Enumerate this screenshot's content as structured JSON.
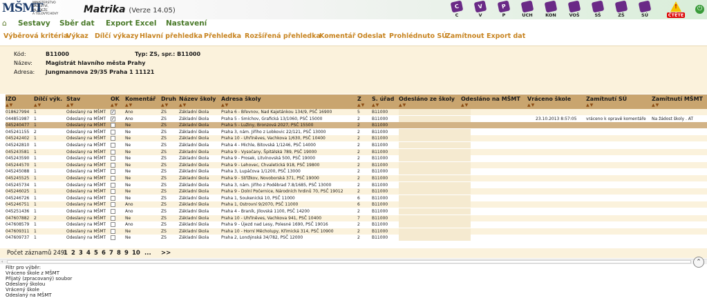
{
  "app": {
    "logo_mark": "MŠMT",
    "logo_text": [
      "MINISTERSTVO",
      "ŠKOLSTVÍ,",
      "MLÁDEŽE",
      "A TĚLOVÝCHOVY"
    ],
    "title": "Matrika",
    "version": "(Verze 14.05)"
  },
  "toolbar_icons": [
    {
      "icon": "c-icon",
      "label": "C"
    },
    {
      "icon": "v-icon",
      "label": "V"
    },
    {
      "icon": "p-icon",
      "label": "P"
    },
    {
      "icon": "uch-icon",
      "label": "UCH"
    },
    {
      "icon": "kon-icon",
      "label": "KON"
    },
    {
      "icon": "vos-icon",
      "label": "VOŠ"
    },
    {
      "icon": "ss-icon",
      "label": "SŠ"
    },
    {
      "icon": "zs-icon",
      "label": "ZŠ"
    },
    {
      "icon": "su-icon",
      "label": "SÚ"
    },
    {
      "icon": "warning-icon",
      "label": "ČTĚTE"
    }
  ],
  "menu": [
    "Sestavy",
    "Sběr dat",
    "Export Excel",
    "Nastavení"
  ],
  "actions": [
    "Výběrová kritéria",
    "Výkaz",
    "Dílčí výkazy",
    "Hlavní přehledka",
    "Přehledka",
    "Rozšířená přehledka",
    "Komentář",
    "Odeslat",
    "Prohlédnuto SÚ",
    "Zamítnout",
    "Export dat"
  ],
  "info": {
    "kod_label": "Kód:",
    "kod_value": "B11000",
    "typ_text": "Typ: ZS, spr.: B11000",
    "nazev_label": "Název:",
    "nazev_value": "Magistrát hlavního města Prahy",
    "adresa_label": "Adresa:",
    "adresa_value": "Jungmannova 29/35 Praha 1 11121"
  },
  "table": {
    "headers": [
      "IZO",
      "Dílčí výk.",
      "Stav",
      "OK",
      "Komentář",
      "Druh",
      "Název školy",
      "Adresa školy",
      "Z",
      "S. úřad",
      "Odesláno ze školy",
      "Odesláno na MŠMT",
      "Vráceno škole",
      "Zamítnutí SÚ",
      "Zamítnutí MŠMT"
    ],
    "sort_glyph": "▲▼",
    "rows": [
      {
        "izo": "018627994",
        "dilci": "1",
        "stav": "Odeslaný na MŠMT",
        "ok": true,
        "kom": "Ano",
        "druh": "ZS",
        "nazev": "Základní škola",
        "adresa": "Praha 6 - Břevnov, Nad Kajetánkou 134/9, PSČ 16900",
        "z": "5",
        "urad": "B11000",
        "vraceno": "",
        "zamsu": "",
        "zammsmt": ""
      },
      {
        "izo": "044851987",
        "dilci": "1",
        "stav": "Odeslaný na MŠMT",
        "ok": true,
        "kom": "Ano",
        "druh": "ZS",
        "nazev": "Základní škola",
        "adresa": "Praha 5 - Smíchov, Grafická 13/1060, PSČ 15000",
        "z": "2",
        "urad": "B11000",
        "vraceno": "23.10.2013 8:57:05",
        "zamsu": "vráceno k opravě komentáře",
        "zammsmt": "Na žádost školy . AT"
      },
      {
        "izo": "045240477",
        "dilci": "1",
        "stav": "Odeslaný na MŠMT",
        "ok": false,
        "kom": "Ne",
        "druh": "ZS",
        "nazev": "Základní škola",
        "adresa": "Praha 5 - Lužiny, Bronzová 2027, PSČ 15500",
        "z": "2",
        "urad": "B11000",
        "vraceno": "",
        "zamsu": "",
        "zammsmt": ""
      },
      {
        "izo": "045241155",
        "dilci": "2",
        "stav": "Odeslaný na MŠMT",
        "ok": false,
        "kom": "Ne",
        "druh": "ZS",
        "nazev": "Základní škola",
        "adresa": "Praha 3, nám. Jiřího z Lobkovic 22/121, PSČ 13000",
        "z": "2",
        "urad": "B11000",
        "vraceno": "",
        "zamsu": "",
        "zammsmt": ""
      },
      {
        "izo": "045242402",
        "dilci": "1",
        "stav": "Odeslaný na MŠMT",
        "ok": false,
        "kom": "Ne",
        "druh": "ZS",
        "nazev": "Základní škola",
        "adresa": "Praha 10 - Uhříněves, Vachkova 1/630, PSČ 10400",
        "z": "2",
        "urad": "B11000",
        "vraceno": "",
        "zamsu": "",
        "zammsmt": ""
      },
      {
        "izo": "045242810",
        "dilci": "1",
        "stav": "Odeslaný na MŠMT",
        "ok": false,
        "kom": "Ne",
        "druh": "ZS",
        "nazev": "Základní škola",
        "adresa": "Praha 4 - Michle, Bitovská 1/1246, PSČ 14000",
        "z": "2",
        "urad": "B11000",
        "vraceno": "",
        "zamsu": "",
        "zammsmt": ""
      },
      {
        "izo": "045243581",
        "dilci": "1",
        "stav": "Odeslaný na MŠMT",
        "ok": false,
        "kom": "Ne",
        "druh": "ZS",
        "nazev": "Základní škola",
        "adresa": "Praha 9 - Vysočany, Špitálská 789, PSČ 19000",
        "z": "2",
        "urad": "B11000",
        "vraceno": "",
        "zamsu": "",
        "zammsmt": ""
      },
      {
        "izo": "045243590",
        "dilci": "1",
        "stav": "Odeslaný na MŠMT",
        "ok": false,
        "kom": "Ne",
        "druh": "ZS",
        "nazev": "Základní škola",
        "adresa": "Praha 9 - Prosek, Litvínovská 500, PSČ 19000",
        "z": "2",
        "urad": "B11000",
        "vraceno": "",
        "zamsu": "",
        "zammsmt": ""
      },
      {
        "izo": "045244570",
        "dilci": "1",
        "stav": "Odeslaný na MŠMT",
        "ok": false,
        "kom": "Ne",
        "druh": "ZS",
        "nazev": "Základní škola",
        "adresa": "Praha 9 - Lehovec, Chvaletická 918, PSČ 19800",
        "z": "2",
        "urad": "B11000",
        "vraceno": "",
        "zamsu": "",
        "zammsmt": ""
      },
      {
        "izo": "045245088",
        "dilci": "1",
        "stav": "Odeslaný na MŠMT",
        "ok": false,
        "kom": "Ne",
        "druh": "ZS",
        "nazev": "Základní škola",
        "adresa": "Praha 3, Lupáčova 1/1200, PSČ 13000",
        "z": "2",
        "urad": "B11000",
        "vraceno": "",
        "zamsu": "",
        "zammsmt": ""
      },
      {
        "izo": "045245525",
        "dilci": "1",
        "stav": "Odeslaný na MŠMT",
        "ok": false,
        "kom": "Ne",
        "druh": "ZS",
        "nazev": "Základní škola",
        "adresa": "Praha 9 - Střížkov, Novoborská 371, PSČ 19000",
        "z": "2",
        "urad": "B11000",
        "vraceno": "",
        "zamsu": "",
        "zammsmt": ""
      },
      {
        "izo": "045245734",
        "dilci": "1",
        "stav": "Odeslaný na MŠMT",
        "ok": false,
        "kom": "Ne",
        "druh": "ZS",
        "nazev": "Základní škola",
        "adresa": "Praha 3, nám. Jiřího z Poděbrad 7.8/1685, PSČ 13000",
        "z": "2",
        "urad": "B11000",
        "vraceno": "",
        "zamsu": "",
        "zammsmt": ""
      },
      {
        "izo": "045246025",
        "dilci": "1",
        "stav": "Odeslaný na MŠMT",
        "ok": false,
        "kom": "Ne",
        "druh": "ZS",
        "nazev": "Základní škola",
        "adresa": "Praha 9 - Dolní Počernice, Národních hrdinů 70, PSČ 19012",
        "z": "2",
        "urad": "B11000",
        "vraceno": "",
        "zamsu": "",
        "zammsmt": ""
      },
      {
        "izo": "045246726",
        "dilci": "1",
        "stav": "Odeslaný na MŠMT",
        "ok": false,
        "kom": "Ne",
        "druh": "ZS",
        "nazev": "Základní škola",
        "adresa": "Praha 1, Soukenická 10, PSČ 11000",
        "z": "6",
        "urad": "B11000",
        "vraceno": "",
        "zamsu": "",
        "zammsmt": ""
      },
      {
        "izo": "045246751",
        "dilci": "1",
        "stav": "Odeslaný na MŠMT",
        "ok": false,
        "kom": "Ano",
        "druh": "ZS",
        "nazev": "Základní škola",
        "adresa": "Praha 1, Ostrovní 9/2070, PSČ 11000",
        "z": "6",
        "urad": "B11000",
        "vraceno": "",
        "zamsu": "",
        "zammsmt": ""
      },
      {
        "izo": "045251436",
        "dilci": "1",
        "stav": "Odeslaný na MŠMT",
        "ok": false,
        "kom": "Ano",
        "druh": "ZS",
        "nazev": "Základní škola",
        "adresa": "Praha 4 - Braník, Jílovská 1100, PSČ 14200",
        "z": "2",
        "urad": "B11000",
        "vraceno": "",
        "zamsu": "",
        "zammsmt": ""
      },
      {
        "izo": "047607882",
        "dilci": "2",
        "stav": "Odeslaný na MŠMT",
        "ok": false,
        "kom": "Ne",
        "druh": "ZS",
        "nazev": "Základní škola",
        "adresa": "Praha 10 - Uhříněves, Vachkova 941, PSČ 10400",
        "z": "7",
        "urad": "B11000",
        "vraceno": "",
        "zamsu": "",
        "zammsmt": ""
      },
      {
        "izo": "047608579",
        "dilci": "1",
        "stav": "Odeslaný na MŠMT",
        "ok": false,
        "kom": "Ano",
        "druh": "ZS",
        "nazev": "Základní škola",
        "adresa": "Praha 9 - Újezd nad Lesy, Polesné 1690, PSČ 19016",
        "z": "2",
        "urad": "B11000",
        "vraceno": "",
        "zamsu": "",
        "zammsmt": ""
      },
      {
        "izo": "047609311",
        "dilci": "1",
        "stav": "Odeslaný na MŠMT",
        "ok": false,
        "kom": "Ne",
        "druh": "ZS",
        "nazev": "Základní škola",
        "adresa": "Praha 10 - Horní Měcholupy, Křimická 314, PSČ 10900",
        "z": "2",
        "urad": "B11000",
        "vraceno": "",
        "zamsu": "",
        "zammsmt": ""
      },
      {
        "izo": "047609737",
        "dilci": "1",
        "stav": "Odeslaný na MŠMT",
        "ok": false,
        "kom": "Ne",
        "druh": "ZS",
        "nazev": "Základní škola",
        "adresa": "Praha 2, Londýnská 34/782, PSČ 12000",
        "z": "2",
        "urad": "B11000",
        "vraceno": "",
        "zamsu": "",
        "zammsmt": ""
      }
    ]
  },
  "footer": {
    "count_text": "Počet záznamů 249",
    "pages": [
      "1",
      "2",
      "3",
      "4",
      "5",
      "6",
      "7",
      "8",
      "9",
      "10",
      "...",
      ">>"
    ]
  },
  "filter": {
    "title": "Filtr pro výběr:",
    "items": [
      "Vráceno škole z MŠMT",
      "Přijatý (zpracovaný) soubor",
      "Odeslaný školou",
      "Vrácený škole",
      "Odeslaný na MŠMT"
    ]
  },
  "colors": {
    "header_bg": "#c9a56f",
    "odd_row": "#fbf2dc",
    "selected_row": "#d2b386",
    "menu_text": "#4a7a2a",
    "action_text": "#c7831f"
  }
}
